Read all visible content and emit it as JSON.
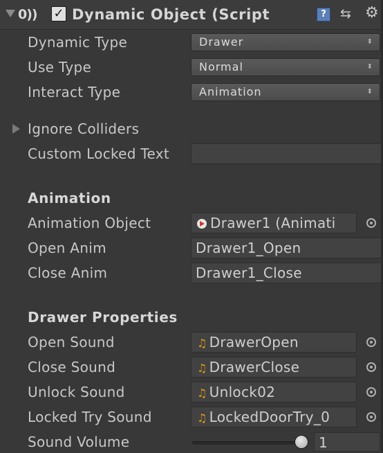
{
  "header": {
    "script_icon": "script-icon",
    "enabled": true,
    "checkbox_glyph": "✓",
    "title": "Dynamic Object (Script",
    "help_glyph": "?",
    "preset_glyph": "⇆",
    "gear_glyph": "⚙"
  },
  "fields": {
    "dynamic_type": {
      "label": "Dynamic Type",
      "value": "Drawer"
    },
    "use_type": {
      "label": "Use Type",
      "value": "Normal"
    },
    "interact_type": {
      "label": "Interact Type",
      "value": "Animation"
    },
    "ignore_colliders": {
      "label": "Ignore Colliders"
    },
    "custom_locked_text": {
      "label": "Custom Locked Text",
      "value": ""
    }
  },
  "animation": {
    "heading": "Animation",
    "animation_object": {
      "label": "Animation Object",
      "value": "Drawer1 (Animati"
    },
    "open_anim": {
      "label": "Open Anim",
      "value": "Drawer1_Open"
    },
    "close_anim": {
      "label": "Close Anim",
      "value": "Drawer1_Close"
    }
  },
  "drawer": {
    "heading": "Drawer Properties",
    "open_sound": {
      "label": "Open Sound",
      "value": "DrawerOpen"
    },
    "close_sound": {
      "label": "Close Sound",
      "value": "DrawerClose"
    },
    "unlock_sound": {
      "label": "Unlock Sound",
      "value": "Unlock02"
    },
    "locked_try_sound": {
      "label": "Locked Try Sound",
      "value": "LockedDoorTry_0"
    },
    "sound_volume": {
      "label": "Sound Volume",
      "value": "1",
      "level": 1.0
    }
  },
  "icons": {
    "dropdown_arrows": "⬍",
    "audio_glyph": "♫"
  },
  "colors": {
    "background": "#383838",
    "audio_icon": "#e79a17",
    "anim_icon": "#d03a2a",
    "help_icon": "#5a7fb8"
  }
}
